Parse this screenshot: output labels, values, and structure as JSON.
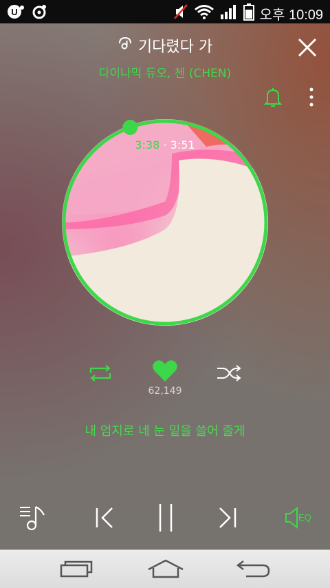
{
  "status_bar": {
    "time": "오후 10:09",
    "icons": [
      "lg-u-plus-icon",
      "media-icon",
      "mute-icon",
      "wifi-icon",
      "signal-icon",
      "battery-icon"
    ]
  },
  "now_playing": {
    "title": "기다렸다 가",
    "artist": "다이나믹 듀오, 첸 (CHEN)",
    "current_time": "3:38",
    "separator": "·",
    "total_time": "3:51",
    "progress": 0.944,
    "like_count": "62,149",
    "lyric": "내 엄지로 네 눈 밑을 쓸어 줄게"
  },
  "buttons": {
    "eq_label": "EQ"
  },
  "colors": {
    "accent": "#3dd84a",
    "background": "#7a7470",
    "status_bar": "#0d0d0d",
    "nav_bar": "#e4e4e4"
  }
}
